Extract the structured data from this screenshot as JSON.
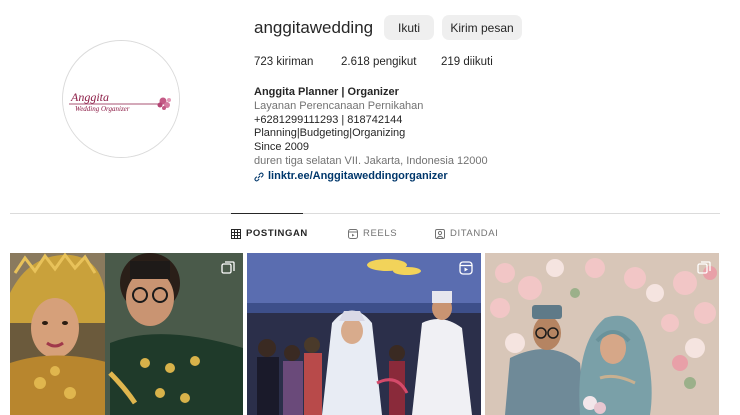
{
  "profile": {
    "username": "anggitawedding",
    "follow_label": "Ikuti",
    "message_label": "Kirim pesan",
    "logo_text_1": "Anggita",
    "logo_text_2": "Wedding Organizer"
  },
  "stats": {
    "posts": "723 kiriman",
    "followers": "2.618 pengikut",
    "following": "219 diikuti"
  },
  "bio": {
    "name": "Anggita Planner | Organizer",
    "category": "Layanan Perencanaan Pernikahan",
    "line1": "+6281299111293 | 818742144",
    "line2": "Planning|Budgeting|Organizing",
    "line3": "Since 2009",
    "address": "duren tiga selatan VII. Jakarta, Indonesia 12000",
    "link": "linktr.ee/Anggitaweddingorganizer"
  },
  "tabs": [
    {
      "label": "POSTINGAN",
      "icon": "grid-icon",
      "active": true
    },
    {
      "label": "REELS",
      "icon": "reels-icon",
      "active": false
    },
    {
      "label": "DITANDAI",
      "icon": "tagged-icon",
      "active": false
    }
  ],
  "posts": [
    {
      "type": "multi-photo",
      "badge": "carousel-icon"
    },
    {
      "type": "reel",
      "badge": "reels-icon"
    },
    {
      "type": "multi-photo",
      "badge": "carousel-icon"
    }
  ],
  "colors": {
    "text": "#262626",
    "muted": "#737373",
    "link": "#00376b",
    "button_bg": "#efefef",
    "border": "#dbdbdb",
    "logo_pink": "#9b1c4a"
  }
}
